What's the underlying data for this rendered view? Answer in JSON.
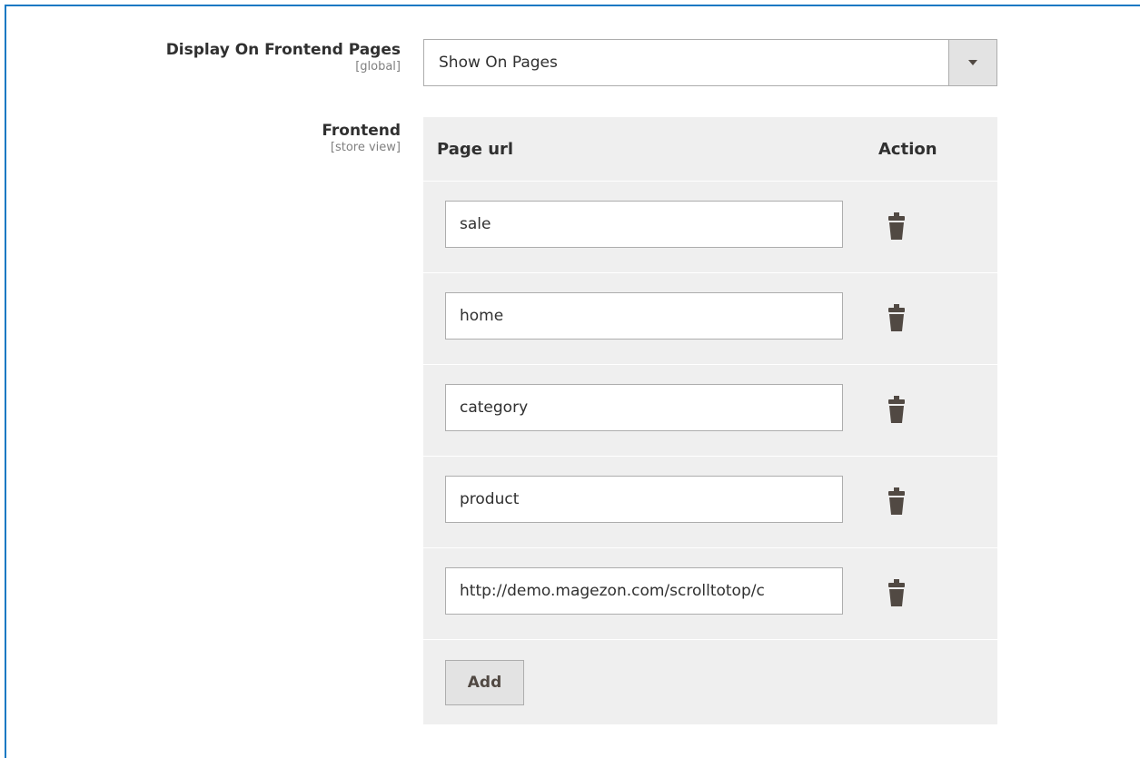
{
  "display_field": {
    "label": "Display On Frontend Pages",
    "scope": "[global]",
    "selected_value": "Show On Pages"
  },
  "frontend_field": {
    "label": "Frontend",
    "scope": "[store view]",
    "table": {
      "headers": [
        "Page url",
        "Action"
      ],
      "rows": [
        {
          "url": "sale"
        },
        {
          "url": "home"
        },
        {
          "url": "category"
        },
        {
          "url": "product"
        },
        {
          "url": "http://demo.magezon.com/scrolltotop/c"
        }
      ],
      "add_label": "Add"
    }
  },
  "icons": {
    "dropdown": "chevron-down-icon",
    "delete": "trash-icon"
  },
  "colors": {
    "focus_border": "#1979c3",
    "table_bg": "#efefef",
    "button_bg": "#e3e3e3",
    "icon": "#514943"
  }
}
